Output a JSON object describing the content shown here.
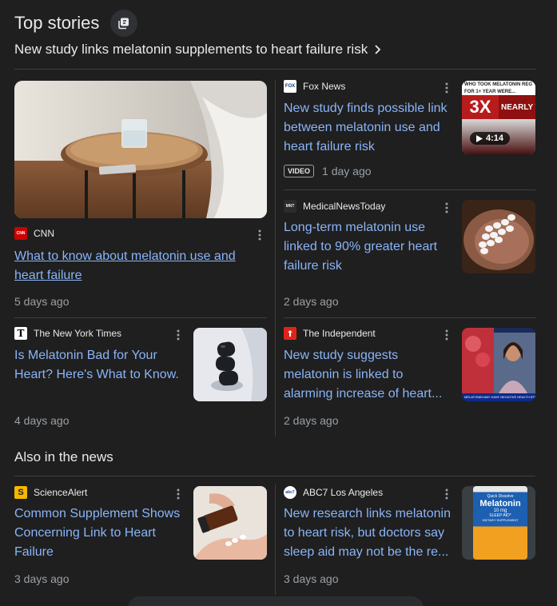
{
  "header": {
    "title": "Top stories",
    "subhead": "New study links melatonin supplements to heart failure risk"
  },
  "stories": {
    "cnn": {
      "source": "CNN",
      "logo_text": "CNN",
      "headline_1": "What to know about melatonin use and",
      "headline_2": "heart failure",
      "age": "5 days ago"
    },
    "fox": {
      "source": "Fox News",
      "logo_text": "FOX",
      "headline_1": "New study finds possible link",
      "headline_2": "between melatonin use and",
      "headline_3": "heart failure risk",
      "badge": "VIDEO",
      "age": "1 day ago",
      "duration": "4:14",
      "thumb_text_1": "WHO TOOK MELATONIN REG",
      "thumb_text_2": "FOR 1+ YEAR WERE...",
      "thumb_text_3": "3X",
      "thumb_text_4": "NEARLY TW"
    },
    "mnt": {
      "source": "MedicalNewsToday",
      "logo_text": "MNT",
      "headline_1": "Long-term melatonin use",
      "headline_2": "linked to 90% greater heart",
      "headline_3": "failure risk",
      "age": "2 days ago"
    },
    "nyt": {
      "source": "The New York Times",
      "logo_text": "T",
      "headline_1": "Is Melatonin Bad for Your",
      "headline_2": "Heart? Here's What to Know.",
      "age": "4 days ago"
    },
    "independent": {
      "source": "The Independent",
      "headline_1": "New study suggests",
      "headline_2": "melatonin is linked to",
      "headline_3": "alarming increase of heart...",
      "age": "2 days ago",
      "thumb_text": "MELATONIN MAY HAVE NEGATIVE HEALTH EFFECTS"
    }
  },
  "also": {
    "title": "Also in the news",
    "sciencealert": {
      "source": "ScienceAlert",
      "logo_text": "S",
      "headline_1": "Common Supplement Shows",
      "headline_2": "Concerning Link to Heart",
      "headline_3": "Failure",
      "age": "3 days ago"
    },
    "abc7": {
      "source": "ABC7 Los Angeles",
      "logo_text": "abc7",
      "headline_1": "New research links melatonin",
      "headline_2": "to heart risk, but doctors say",
      "headline_3": "sleep aid may not be the re...",
      "age": "3 days ago",
      "bottle_text_1": "Quick Dissolve",
      "bottle_text_2": "Melatonin",
      "bottle_text_3": "10 mg",
      "bottle_text_4": "SLEEP AID*",
      "bottle_text_5": "DIETARY SUPPLEMENT"
    }
  },
  "colors": {
    "background": "#1f1f1f",
    "link": "#8ab4f8",
    "meta": "#9aa0a6",
    "divider": "#3c4043"
  }
}
